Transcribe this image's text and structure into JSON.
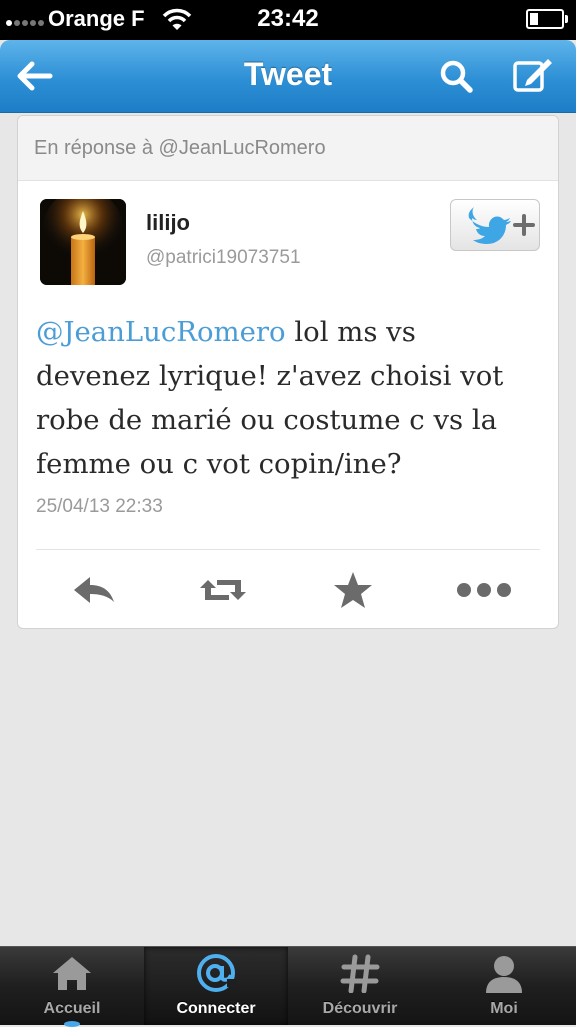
{
  "status_bar": {
    "carrier": "Orange F",
    "time": "23:42"
  },
  "nav": {
    "title": "Tweet"
  },
  "tweet": {
    "reply_context": "En réponse à @JeanLucRomero",
    "author_name": "lilijo",
    "author_handle": "@patrici19073751",
    "mention": "@JeanLucRomero",
    "text": " lol ms vs devenez lyrique! z'avez choisi vot robe de marié ou costume c vs la femme ou c vot copin/ine?",
    "timestamp": "25/04/13 22:33"
  },
  "tabs": [
    {
      "label": "Accueil",
      "icon": "home-icon",
      "active": false
    },
    {
      "label": "Connecter",
      "icon": "at-icon",
      "active": true
    },
    {
      "label": "Découvrir",
      "icon": "hashtag-icon",
      "active": false
    },
    {
      "label": "Moi",
      "icon": "person-icon",
      "active": false
    }
  ],
  "colors": {
    "nav_blue": "#2d8fd5",
    "mention_blue": "#4a9dd6",
    "accent": "#49a6e8"
  }
}
